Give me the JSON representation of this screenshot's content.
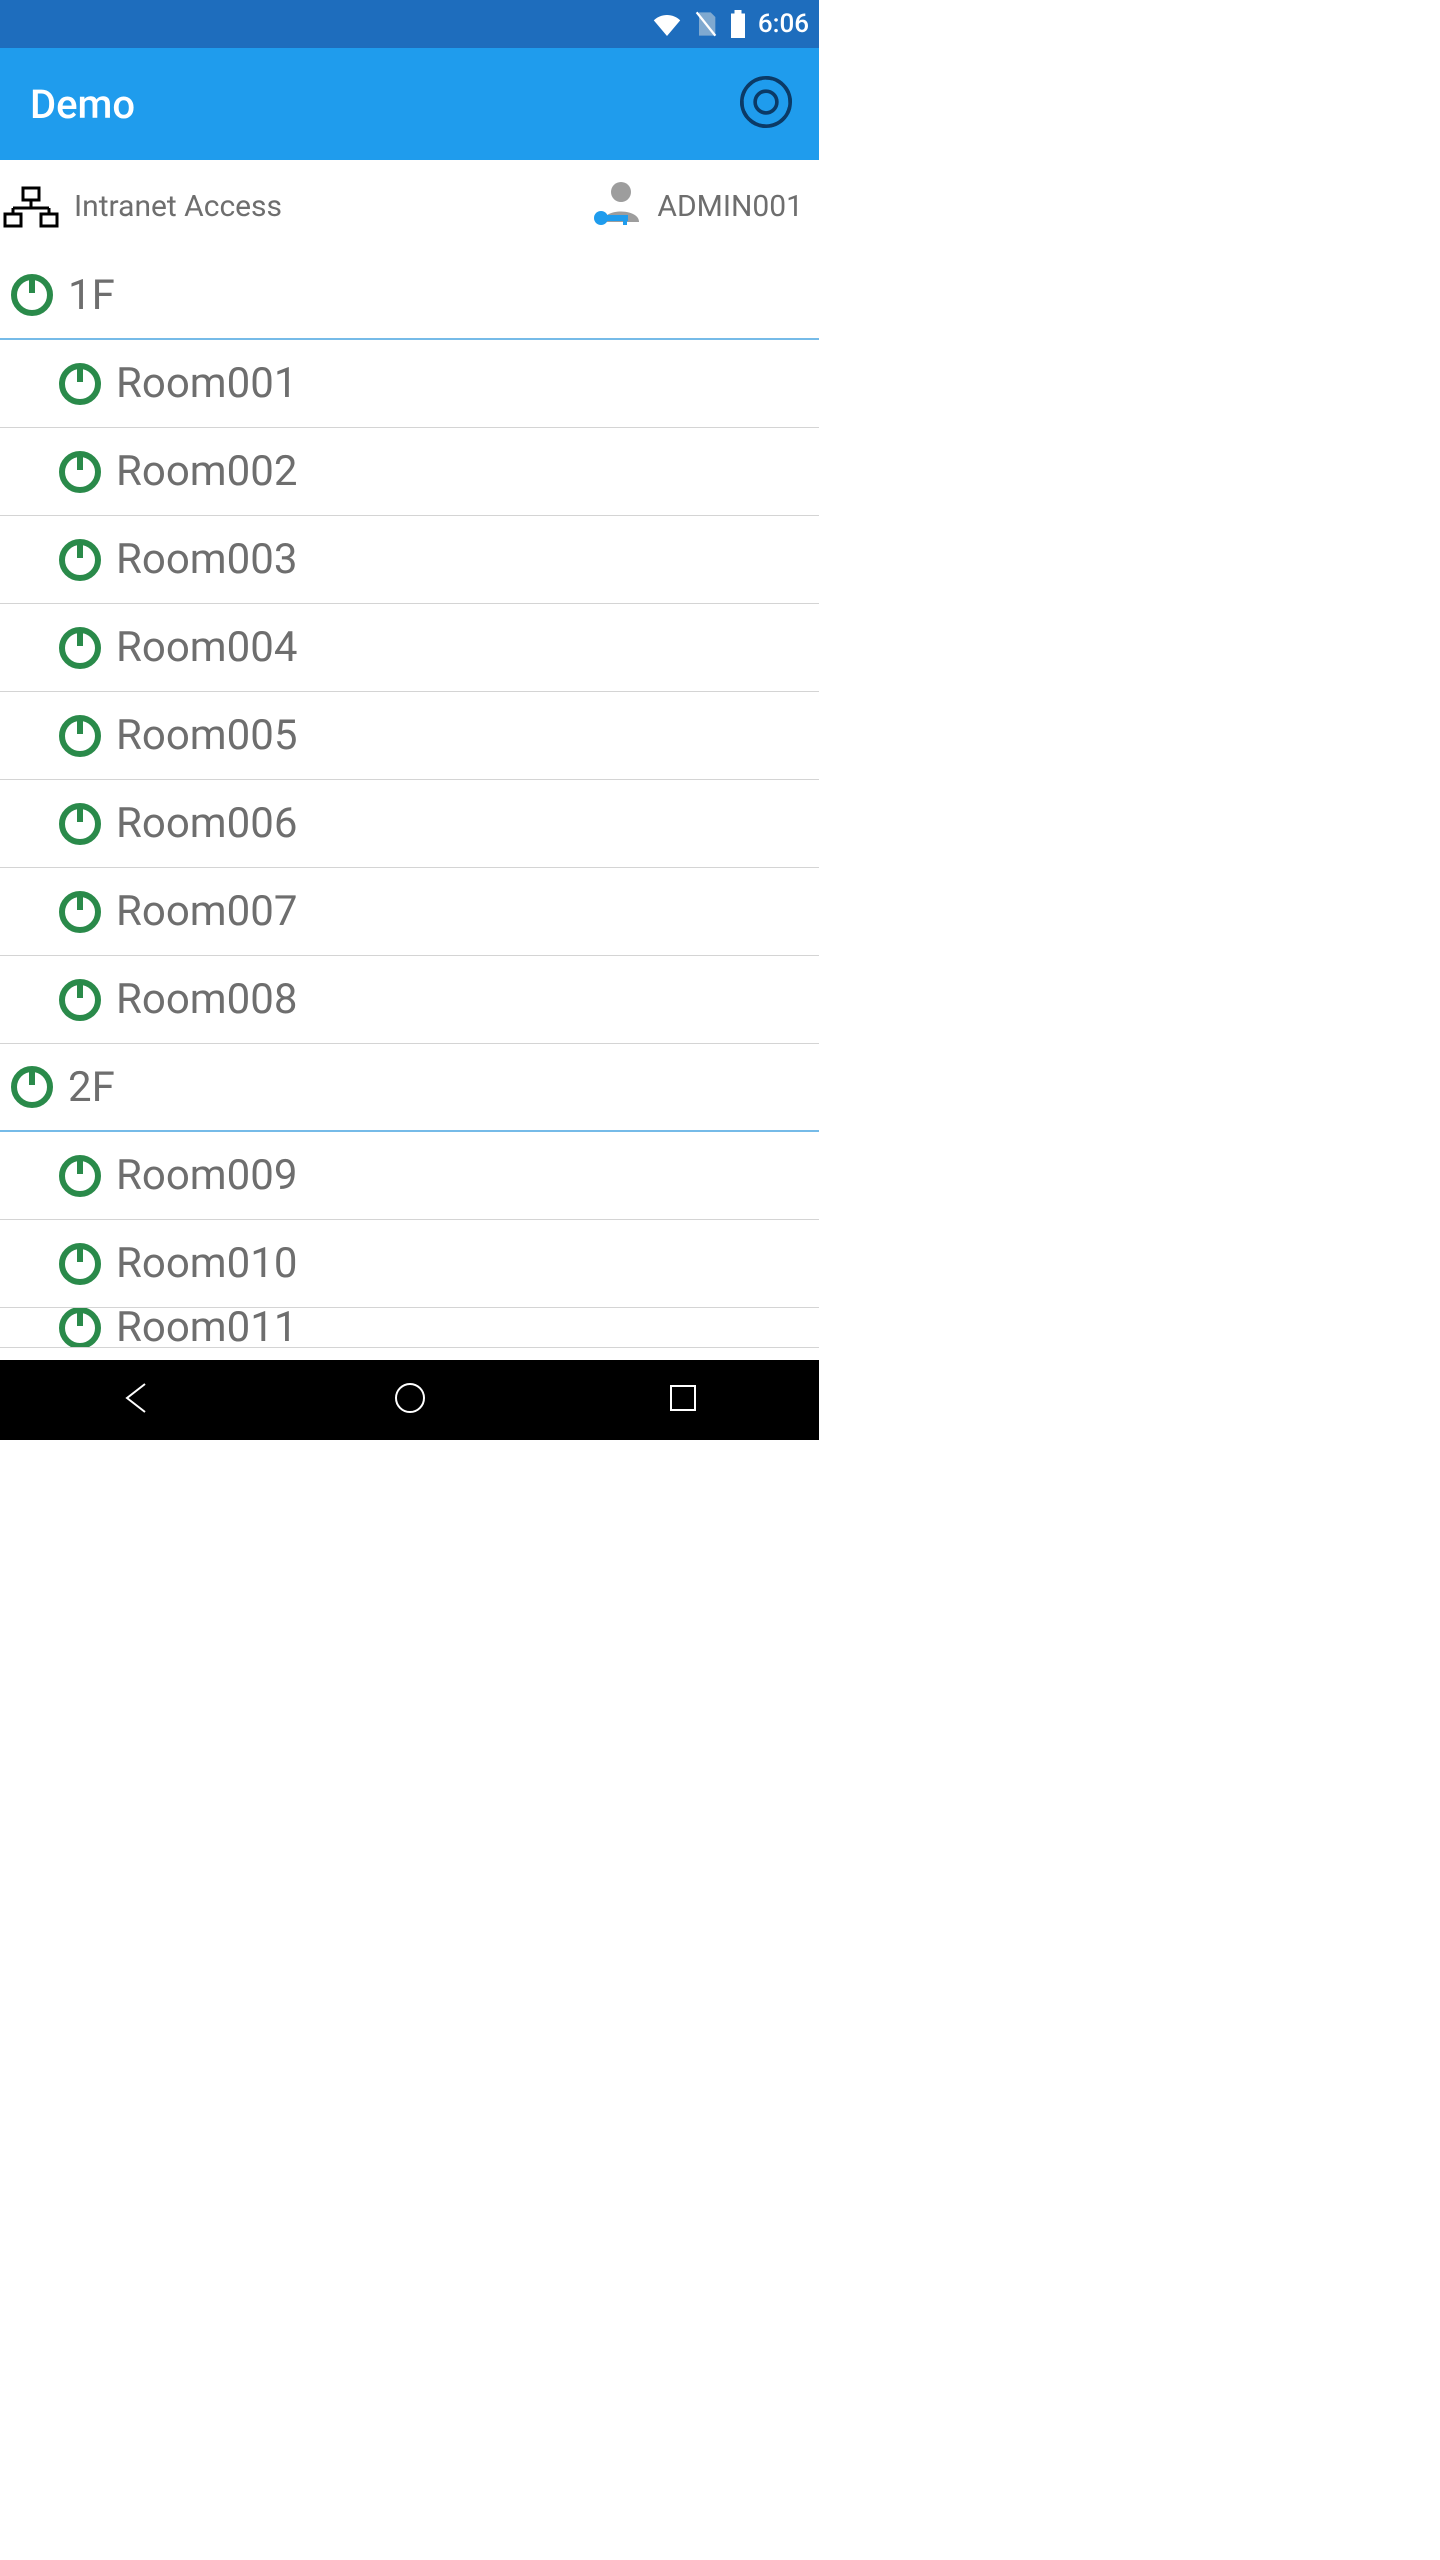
{
  "status": {
    "clock": "6:06"
  },
  "header": {
    "title": "Demo"
  },
  "info": {
    "network_label": "Intranet Access",
    "user_label": "ADMIN001"
  },
  "floors": [
    {
      "label": "1F",
      "rooms": [
        {
          "label": "Room001"
        },
        {
          "label": "Room002"
        },
        {
          "label": "Room003"
        },
        {
          "label": "Room004"
        },
        {
          "label": "Room005"
        },
        {
          "label": "Room006"
        },
        {
          "label": "Room007"
        },
        {
          "label": "Room008"
        }
      ]
    },
    {
      "label": "2F",
      "rooms": [
        {
          "label": "Room009"
        },
        {
          "label": "Room010"
        },
        {
          "label": "Room011"
        }
      ]
    }
  ],
  "colors": {
    "power_icon": "#2a8a4a"
  }
}
